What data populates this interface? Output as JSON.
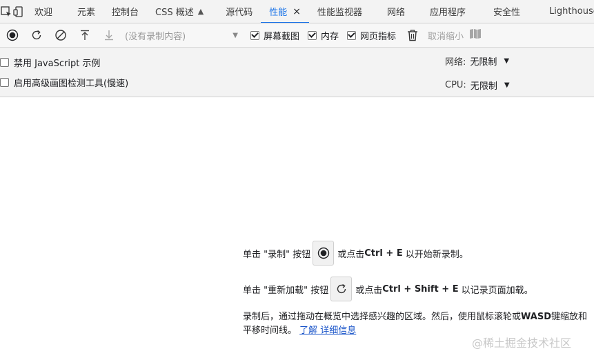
{
  "tabbar": {
    "icons": [
      "inspect-element-icon",
      "device-toolbar-icon"
    ],
    "tabs": [
      {
        "label": "欢迎"
      },
      {
        "label": "元素"
      },
      {
        "label": "控制台"
      },
      {
        "label": "CSS 概述"
      },
      {
        "label": "源代码"
      },
      {
        "label": "性能",
        "active": true
      },
      {
        "label": "性能监视器"
      },
      {
        "label": "网络"
      },
      {
        "label": "应用程序"
      },
      {
        "label": "安全性"
      },
      {
        "label": "Lighthouse"
      }
    ],
    "active_close": "×"
  },
  "toolbar": {
    "profile_placeholder": "(没有录制内容)",
    "screenshots_label": "屏幕截图",
    "memory_label": "内存",
    "web_vitals_label": "网页指标",
    "zoom_out_label": "取消缩小",
    "screenshots_checked": true,
    "memory_checked": true,
    "web_vitals_checked": true
  },
  "settings": {
    "disable_js_samples": "禁用 JavaScript 示例",
    "advanced_paint": "启用高级画图检测工具(慢速)",
    "network_label": "网络:",
    "network_value": "无限制",
    "cpu_label": "CPU:",
    "cpu_value": "无限制"
  },
  "landing": {
    "line1_prefix": "单击 \"录制\" 按钮",
    "line1_mid": "或点击",
    "line1_keys": "Ctrl + E",
    "line1_suffix": "以开始新录制。",
    "line2_prefix": "单击 \"重新加载\" 按钮",
    "line2_mid": "或点击",
    "line2_keys": "Ctrl + Shift + E",
    "line2_suffix": "以记录页面加载。",
    "para_text": "录制后，通过拖动在概览中选择感兴趣的区域。然后，使用鼠标滚轮或",
    "para_keys": "WASD",
    "para_text2": "键缩放和平移时间线。",
    "learn_more": "了解 详细信息"
  },
  "watermark": "@稀土掘金技术社区"
}
